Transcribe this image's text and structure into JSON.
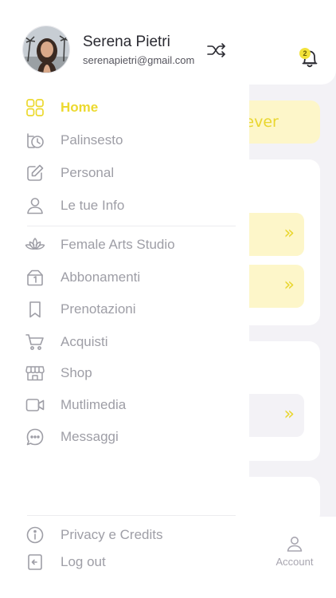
{
  "background": {
    "banner_text": "rever",
    "notification_count": "2",
    "bottom_nav": {
      "account_label": "Account"
    },
    "chevron": "»"
  },
  "drawer": {
    "user": {
      "name": "Serena Pietri",
      "email": "serenapietri@gmail.com"
    },
    "menu": [
      {
        "label": "Home",
        "icon": "grid-icon",
        "active": true
      },
      {
        "label": "Palinsesto",
        "icon": "schedule-history-icon"
      },
      {
        "label": "Personal",
        "icon": "edit-icon"
      },
      {
        "label": "Le tue Info",
        "icon": "user-icon"
      },
      {
        "label": "Female Arts Studio",
        "icon": "lotus-icon"
      },
      {
        "label": "Abbonamenti",
        "icon": "membership-bag-icon"
      },
      {
        "label": "Prenotazioni",
        "icon": "bookmark-icon"
      },
      {
        "label": "Acquisti",
        "icon": "cart-icon"
      },
      {
        "label": "Shop",
        "icon": "store-icon"
      },
      {
        "label": "Mutlimedia",
        "icon": "video-icon"
      },
      {
        "label": "Messaggi",
        "icon": "chat-icon"
      }
    ],
    "footer": [
      {
        "label": "Privacy e Credits",
        "icon": "info-icon"
      },
      {
        "label": "Log out",
        "icon": "logout-icon"
      }
    ]
  },
  "colors": {
    "accent": "#ecd92e",
    "accent_light": "#fdf6c9",
    "text_muted": "#9e9ea6",
    "background": "#f3f2f6"
  }
}
